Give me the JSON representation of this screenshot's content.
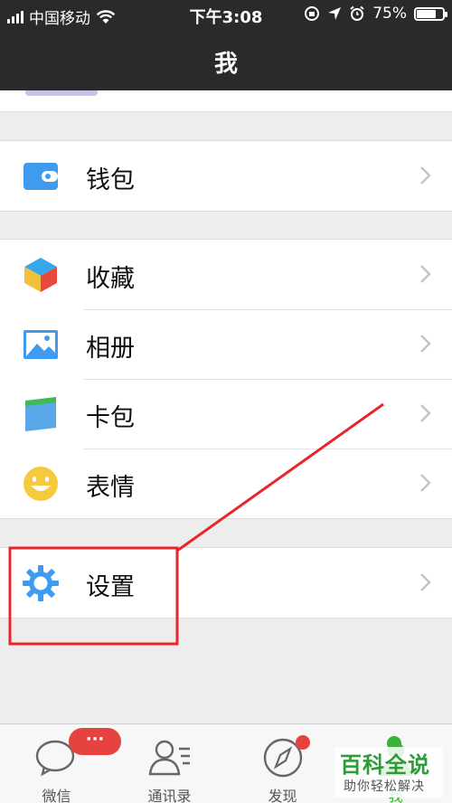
{
  "status_bar": {
    "carrier": "中国移动",
    "time": "下午3:08",
    "battery": "75%",
    "battery_level": 0.75,
    "icons": [
      "signal-icon",
      "wifi-icon",
      "rotation-lock-icon",
      "location-icon",
      "alarm-icon",
      "battery-icon"
    ]
  },
  "nav": {
    "title": "我"
  },
  "groups": [
    {
      "items": [
        {
          "label": "钱包",
          "icon": "wallet-icon"
        }
      ]
    },
    {
      "items": [
        {
          "label": "收藏",
          "icon": "favorites-icon"
        },
        {
          "label": "相册",
          "icon": "album-icon"
        },
        {
          "label": "卡包",
          "icon": "card-wallet-icon"
        },
        {
          "label": "表情",
          "icon": "sticker-icon"
        }
      ]
    },
    {
      "items": [
        {
          "label": "设置",
          "icon": "settings-icon"
        }
      ]
    }
  ],
  "tabbar": {
    "tabs": [
      {
        "label": "微信",
        "icon": "chat-icon",
        "badge": "···"
      },
      {
        "label": "通讯录",
        "icon": "contacts-icon"
      },
      {
        "label": "发现",
        "icon": "discover-icon"
      },
      {
        "label": "我",
        "icon": "me-icon"
      }
    ]
  },
  "watermark": {
    "title": "百科全说",
    "subtitle": "助你轻松解决"
  },
  "colors": {
    "nav_bg": "#2a2a2a",
    "accent_blue": "#3e9bef",
    "badge_red": "#e64340",
    "annotation_red": "#e8262a"
  }
}
